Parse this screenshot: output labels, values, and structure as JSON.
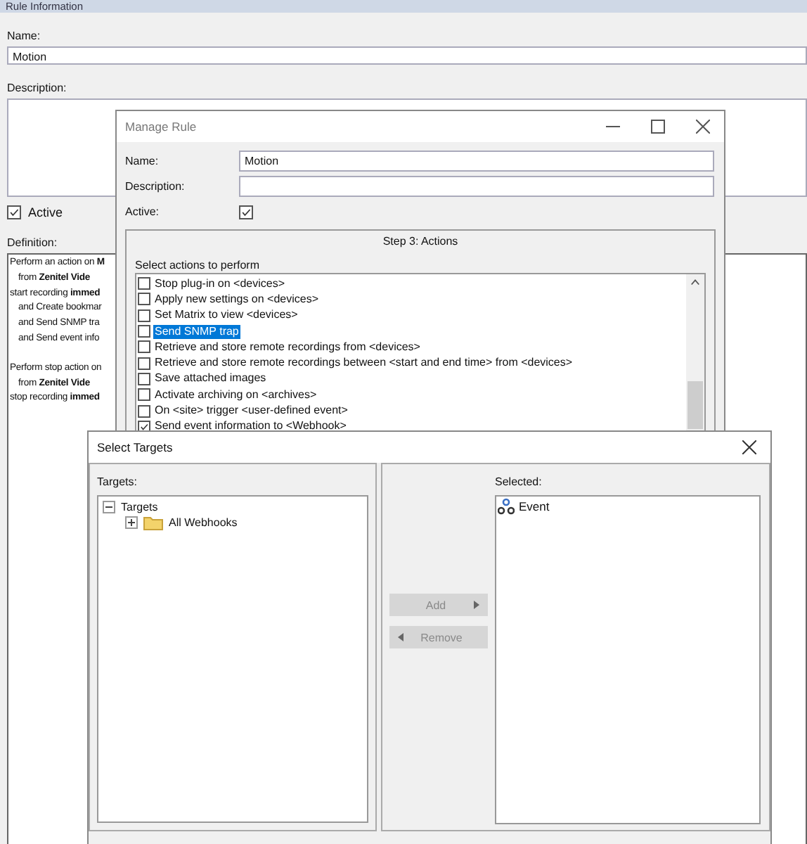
{
  "rule_information": {
    "title": "Rule Information",
    "name_label": "Name:",
    "name_value": "Motion",
    "description_label": "Description:",
    "active": {
      "label": "Active",
      "checked": true
    },
    "definition_label": "Definition:",
    "definition": [
      [
        {
          "kind": "lead",
          "text": "Perform an action on **M**"
        },
        {
          "kind": "sub",
          "text": "from **Zenitel Vide**"
        },
        {
          "kind": "lead",
          "text": "start recording **immed**"
        },
        {
          "kind": "sub",
          "text": "and Create bookmar"
        },
        {
          "kind": "sub",
          "text": "and Send SNMP tra"
        },
        {
          "kind": "sub",
          "text": "and Send event info"
        }
      ],
      [
        {
          "kind": "lead",
          "text": "Perform stop action on"
        },
        {
          "kind": "sub",
          "text": "from **Zenitel Vide**"
        },
        {
          "kind": "lead",
          "text": "stop recording **immed**"
        }
      ]
    ]
  },
  "manage_rule": {
    "title": "Manage Rule",
    "name_label": "Name:",
    "name_value": "Motion",
    "description_label": "Description:",
    "active": {
      "label": "Active:",
      "checked": true
    },
    "step_title": "Step 3: Actions",
    "actions_label": "Select actions to perform",
    "actions": [
      {
        "label": "Stop plug-in on <devices>",
        "checked": false,
        "selected": false
      },
      {
        "label": "Apply new settings on <devices>",
        "checked": false,
        "selected": false
      },
      {
        "label": "Set Matrix to view <devices>",
        "checked": false,
        "selected": false
      },
      {
        "label": "Send SNMP trap",
        "checked": false,
        "selected": true
      },
      {
        "label": "Retrieve and store remote recordings from <devices>",
        "checked": false,
        "selected": false
      },
      {
        "label": "Retrieve and store remote recordings between <start and end time> from <devices>",
        "checked": false,
        "selected": false
      },
      {
        "label": "Save attached images",
        "checked": false,
        "selected": false
      },
      {
        "label": "Activate archiving on <archives>",
        "checked": false,
        "selected": false
      },
      {
        "label": "On <site> trigger <user-defined event>",
        "checked": false,
        "selected": false
      },
      {
        "label": "Send event information to <Webhook>",
        "checked": true,
        "selected": false
      }
    ]
  },
  "select_targets": {
    "title": "Select Targets",
    "targets_label": "Targets:",
    "tree": [
      {
        "label": "Targets",
        "expanded": true,
        "children": [
          {
            "label": "All Webhooks",
            "expanded": false
          }
        ]
      }
    ],
    "buttons": [
      {
        "kind": "add",
        "label": "Add",
        "disabled": true
      },
      {
        "kind": "remove",
        "label": "Remove",
        "disabled": true
      }
    ],
    "selected_label": "Selected:",
    "selected_items": [
      "Event"
    ]
  }
}
